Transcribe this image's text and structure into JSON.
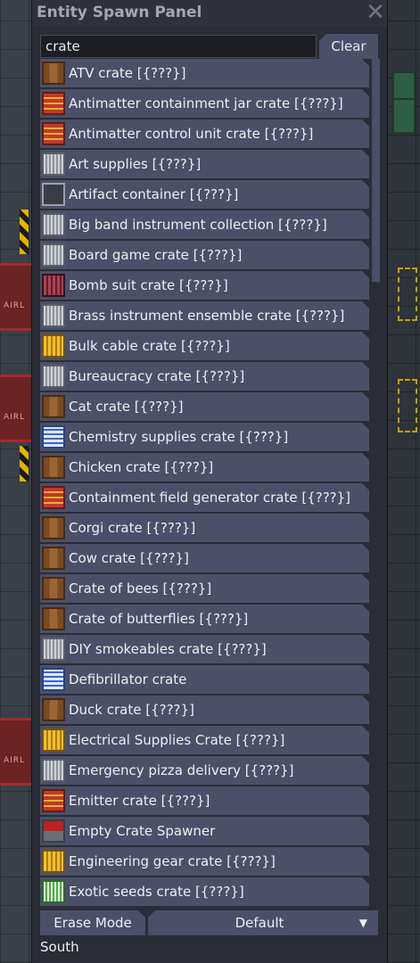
{
  "window": {
    "title": "Entity Spawn Panel",
    "close_symbol": "✕"
  },
  "search": {
    "value": "crate",
    "clear_label": "Clear"
  },
  "items": [
    {
      "label": "ATV crate [{???}]",
      "icon": "wooden-crate-icon",
      "style": "wood"
    },
    {
      "label": "Antimatter containment jar crate [{???}]",
      "icon": "red-crate-icon",
      "style": "red"
    },
    {
      "label": "Antimatter control unit crate [{???}]",
      "icon": "red-crate-icon",
      "style": "red"
    },
    {
      "label": "Art supplies [{???}]",
      "icon": "gray-crate-icon",
      "style": "gray"
    },
    {
      "label": "Artifact container [{???}]",
      "icon": "artifact-container-icon",
      "style": "artifact"
    },
    {
      "label": "Big band instrument collection [{???}]",
      "icon": "gray-crate-icon",
      "style": "gray"
    },
    {
      "label": "Board game crate [{???}]",
      "icon": "gray-crate-icon",
      "style": "gray"
    },
    {
      "label": "Bomb suit crate [{???}]",
      "icon": "maroon-crate-icon",
      "style": "maroon"
    },
    {
      "label": "Brass instrument ensemble crate [{???}]",
      "icon": "gray-crate-icon",
      "style": "gray"
    },
    {
      "label": "Bulk cable crate [{???}]",
      "icon": "yellow-crate-icon",
      "style": "yellow"
    },
    {
      "label": "Bureaucracy crate [{???}]",
      "icon": "gray-crate-icon",
      "style": "gray"
    },
    {
      "label": "Cat crate [{???}]",
      "icon": "wooden-crate-icon",
      "style": "wood"
    },
    {
      "label": "Chemistry supplies crate [{???}]",
      "icon": "blue-crate-icon",
      "style": "blue"
    },
    {
      "label": "Chicken crate [{???}]",
      "icon": "wooden-crate-icon",
      "style": "wood"
    },
    {
      "label": "Containment field generator crate [{???}]",
      "icon": "red-crate-icon",
      "style": "red"
    },
    {
      "label": "Corgi crate [{???}]",
      "icon": "wooden-crate-icon",
      "style": "wood"
    },
    {
      "label": "Cow crate [{???}]",
      "icon": "wooden-crate-icon",
      "style": "wood"
    },
    {
      "label": "Crate of bees [{???}]",
      "icon": "wooden-crate-icon",
      "style": "wood"
    },
    {
      "label": "Crate of butterflies [{???}]",
      "icon": "wooden-crate-icon",
      "style": "wood"
    },
    {
      "label": "DIY smokeables crate [{???}]",
      "icon": "gray-crate-icon",
      "style": "gray"
    },
    {
      "label": "Defibrillator crate",
      "icon": "blue-crate-icon",
      "style": "blue"
    },
    {
      "label": "Duck crate [{???}]",
      "icon": "wooden-crate-icon",
      "style": "wood"
    },
    {
      "label": "Electrical Supplies Crate [{???}]",
      "icon": "yellow-crate-icon",
      "style": "yellow"
    },
    {
      "label": "Emergency pizza delivery [{???}]",
      "icon": "gray-crate-icon",
      "style": "gray"
    },
    {
      "label": "Emitter crate [{???}]",
      "icon": "red-crate-icon",
      "style": "red"
    },
    {
      "label": "Empty Crate Spawner",
      "icon": "crate-spawner-icon",
      "style": "spawner"
    },
    {
      "label": "Engineering gear crate [{???}]",
      "icon": "yellow-crate-icon",
      "style": "yellow"
    },
    {
      "label": "Exotic seeds crate [{???}]",
      "icon": "green-crate-icon",
      "style": "green"
    }
  ],
  "footer": {
    "erase_label": "Erase Mode",
    "mode_value": "Default",
    "mode_arrow": "▼",
    "direction": "South"
  },
  "colors": {
    "panel": "#2a2d36",
    "item": "#4b5068",
    "title_text": "#a5a7ad",
    "text": "#eeeef2"
  },
  "backdrop": {
    "airlock_label": "AIRL"
  }
}
